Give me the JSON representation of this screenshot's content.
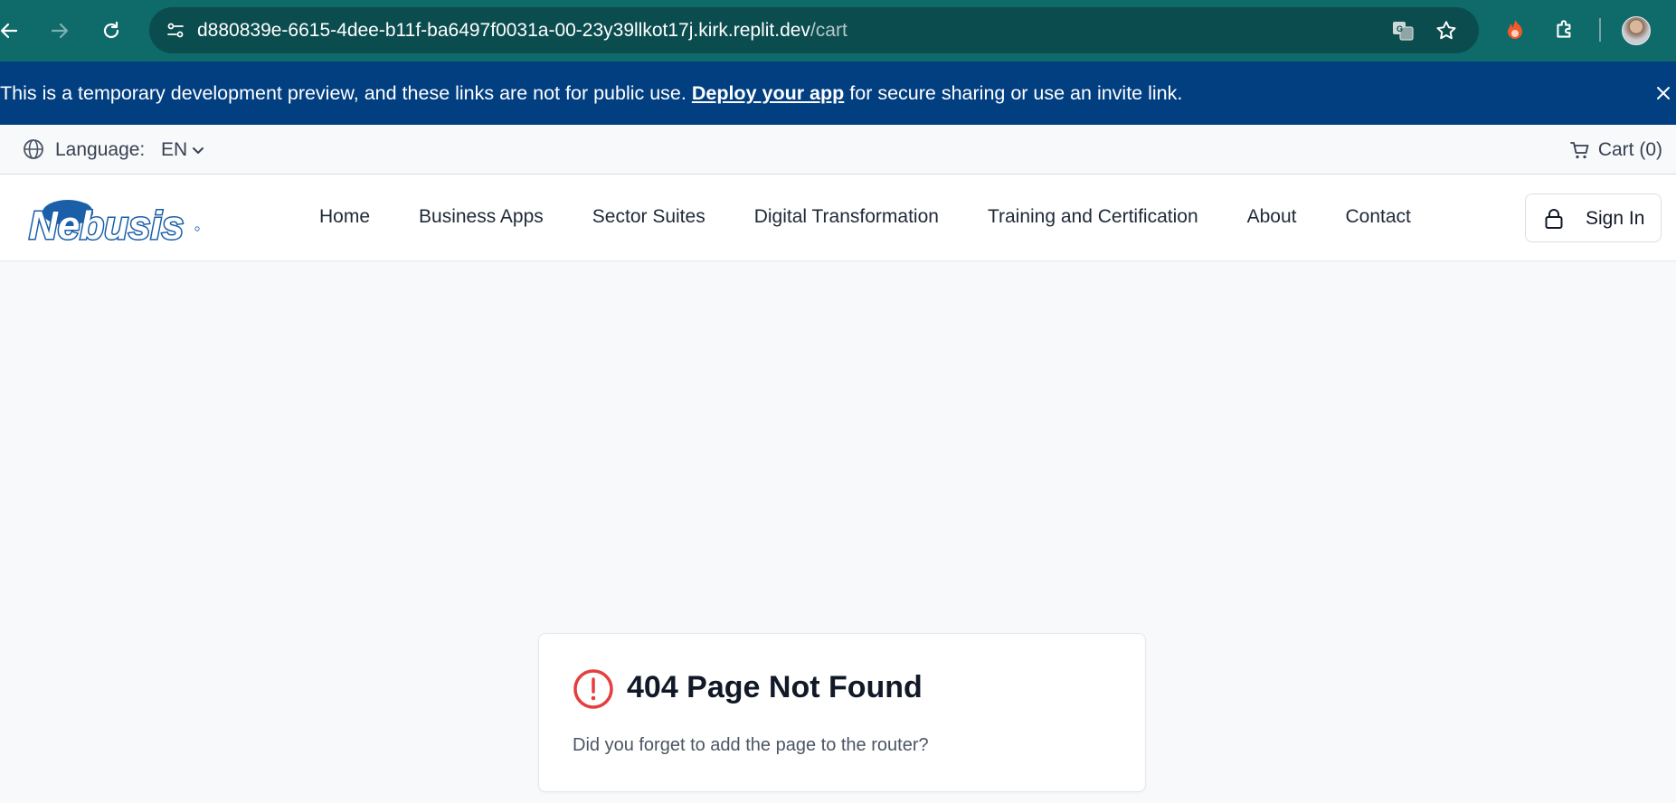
{
  "browser": {
    "url_host": "d880839e-6615-4dee-b11f-ba6497f0031a-00-23y39llkot17j.kirk.replit.dev",
    "url_path": "/cart",
    "icons": [
      "back-arrow-icon",
      "forward-arrow-icon",
      "reload-icon",
      "site-info-icon",
      "translate-icon",
      "bookmark-star-icon",
      "extension-flame-icon",
      "extensions-puzzle-icon",
      "profile-avatar"
    ]
  },
  "banner": {
    "text_before": "This is a temporary development preview, and these links are not for public use. ",
    "link_text": "Deploy your app",
    "text_after": " for secure sharing or use an invite link.",
    "close_icon": "close-icon",
    "background": "#023f80"
  },
  "langbar": {
    "language_label": "Language:",
    "language_value": "EN",
    "cart_label": "Cart (0)"
  },
  "header": {
    "logo_text": "Nebusis",
    "nav": [
      "Home",
      "Business Apps",
      "Sector Suites",
      "Digital Transformation",
      "Training and Certification",
      "About",
      "Contact"
    ],
    "signin_label": "Sign In",
    "brand_color": "#1a5fa8"
  },
  "error_card": {
    "title": "404 Page Not Found",
    "message": "Did you forget to add the page to the router?",
    "icon_color": "#e53e3e"
  }
}
